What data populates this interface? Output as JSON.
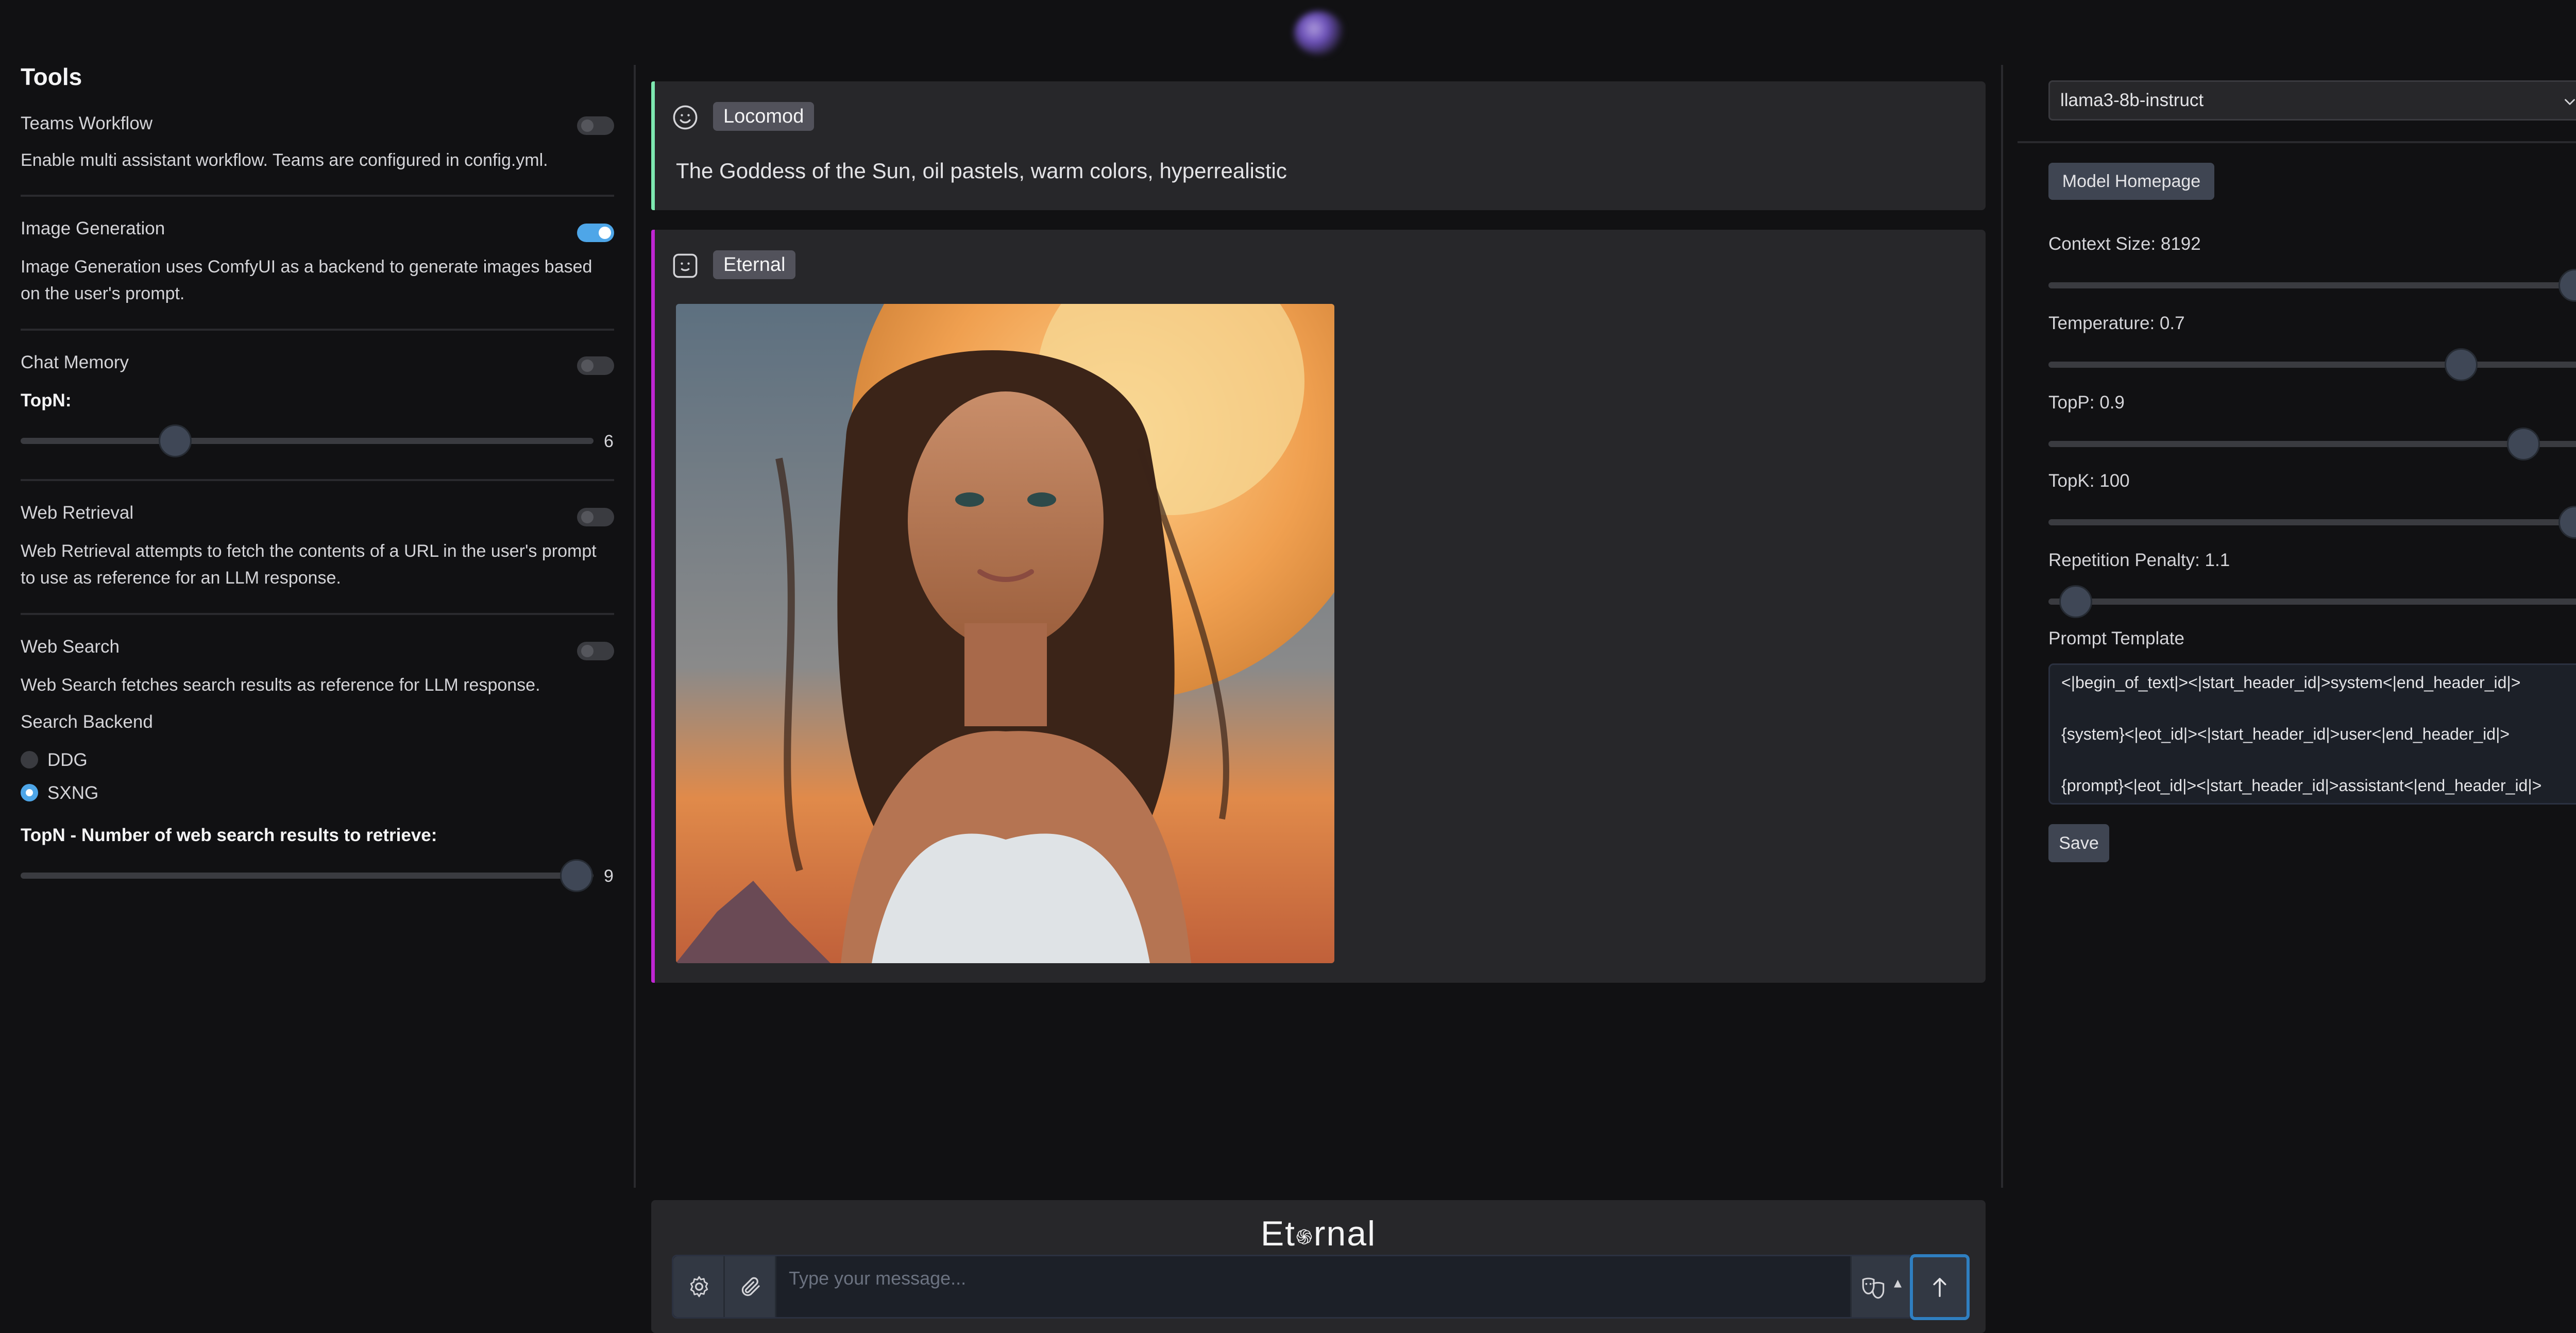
{
  "tools": {
    "title": "Tools",
    "teams_workflow": {
      "label": "Teams Workflow",
      "description": "Enable multi assistant workflow. Teams are configured in config.yml.",
      "enabled": false
    },
    "image_generation": {
      "label": "Image Generation",
      "description_line1": "Image Generation uses ComfyUI as a backend to generate images based",
      "description_line2": "on the user's prompt.",
      "enabled": true
    },
    "chat_memory": {
      "label": "Chat Memory",
      "enabled": false,
      "topn_label": "TopN:",
      "topn_value": "6",
      "topn_fraction": 0.27
    },
    "web_retrieval": {
      "label": "Web Retrieval",
      "description_line1": "Web Retrieval attempts to fetch the contents of a URL in the user's prompt",
      "description_line2": "to use as reference for an LLM response.",
      "enabled": false
    },
    "web_search": {
      "label": "Web Search",
      "description": "Web Search fetches search results as reference for LLM response.",
      "enabled": false,
      "backend_label": "Search Backend",
      "backends": [
        "DDG",
        "SXNG"
      ],
      "selected_backend": "SXNG",
      "topn_label": "TopN - Number of web search results to retrieve:",
      "topn_value": "9",
      "topn_fraction": 0.97
    }
  },
  "chat": {
    "messages": [
      {
        "sender": "Locomod",
        "text": "The Goddess of the Sun, oil pastels, warm colors, hyperrealistic",
        "accent": "#7ee8b0"
      },
      {
        "sender": "Eternal",
        "text": "",
        "accent": "#c026d3",
        "has_image": true
      }
    ],
    "composer": {
      "brand_before": "Et",
      "brand_after": "rnal",
      "placeholder": "Type your message..."
    }
  },
  "settings": {
    "model": "llama3-8b-instruct",
    "model_homepage_label": "Model Homepage",
    "params": [
      {
        "label": "Context Size: 8192",
        "fraction": 0.97
      },
      {
        "label": "Temperature: 0.7",
        "fraction": 0.76
      },
      {
        "label": "TopP: 0.9",
        "fraction": 0.875
      },
      {
        "label": "TopK: 100",
        "fraction": 0.97
      },
      {
        "label": "Repetition Penalty: 1.1",
        "fraction": 0.05
      }
    ],
    "prompt_template_label": "Prompt Template",
    "prompt_template_lines": [
      "<|begin_of_text|><|start_header_id|>system<|end_header_id|>",
      "{system}<|eot_id|><|start_header_id|>user<|end_header_id|>",
      "{prompt}<|eot_id|><|start_header_id|>assistant<|end_header_id|>"
    ],
    "save_label": "Save"
  },
  "colors": {
    "background": "#111113",
    "panel": "#27272a",
    "accent_blue": "#4ea6e8",
    "user_accent": "#7ee8b0",
    "assistant_accent": "#c026d3"
  }
}
